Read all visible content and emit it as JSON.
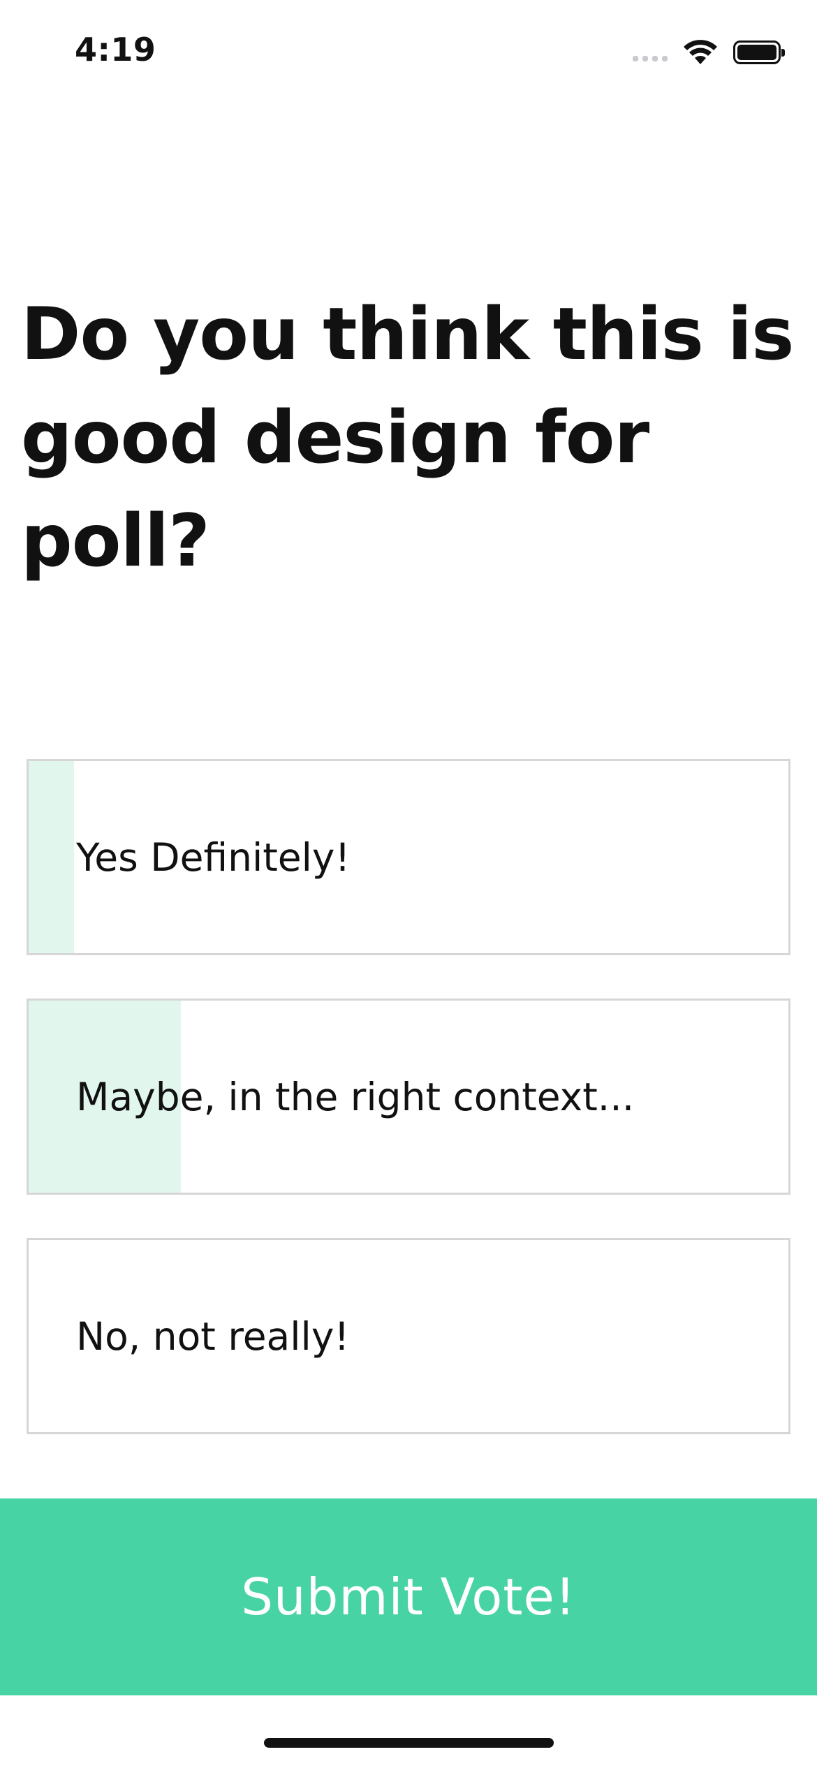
{
  "status_bar": {
    "time": "4:19",
    "icons": [
      "signal-icon",
      "wifi-icon",
      "battery-icon"
    ]
  },
  "poll": {
    "question": "Do you think this is good design for poll?",
    "options": [
      {
        "label": "Yes Definitely!",
        "result_fraction": 0.06
      },
      {
        "label": "Maybe, in the right context...",
        "result_fraction": 0.2
      },
      {
        "label": "No, not really!",
        "result_fraction": 0
      }
    ]
  },
  "submit": {
    "label": "Submit Vote!"
  },
  "colors": {
    "accent": "#48d3a5",
    "result_fill": "#e1f7ee",
    "option_border": "#d6d6d6",
    "text": "#111111"
  }
}
